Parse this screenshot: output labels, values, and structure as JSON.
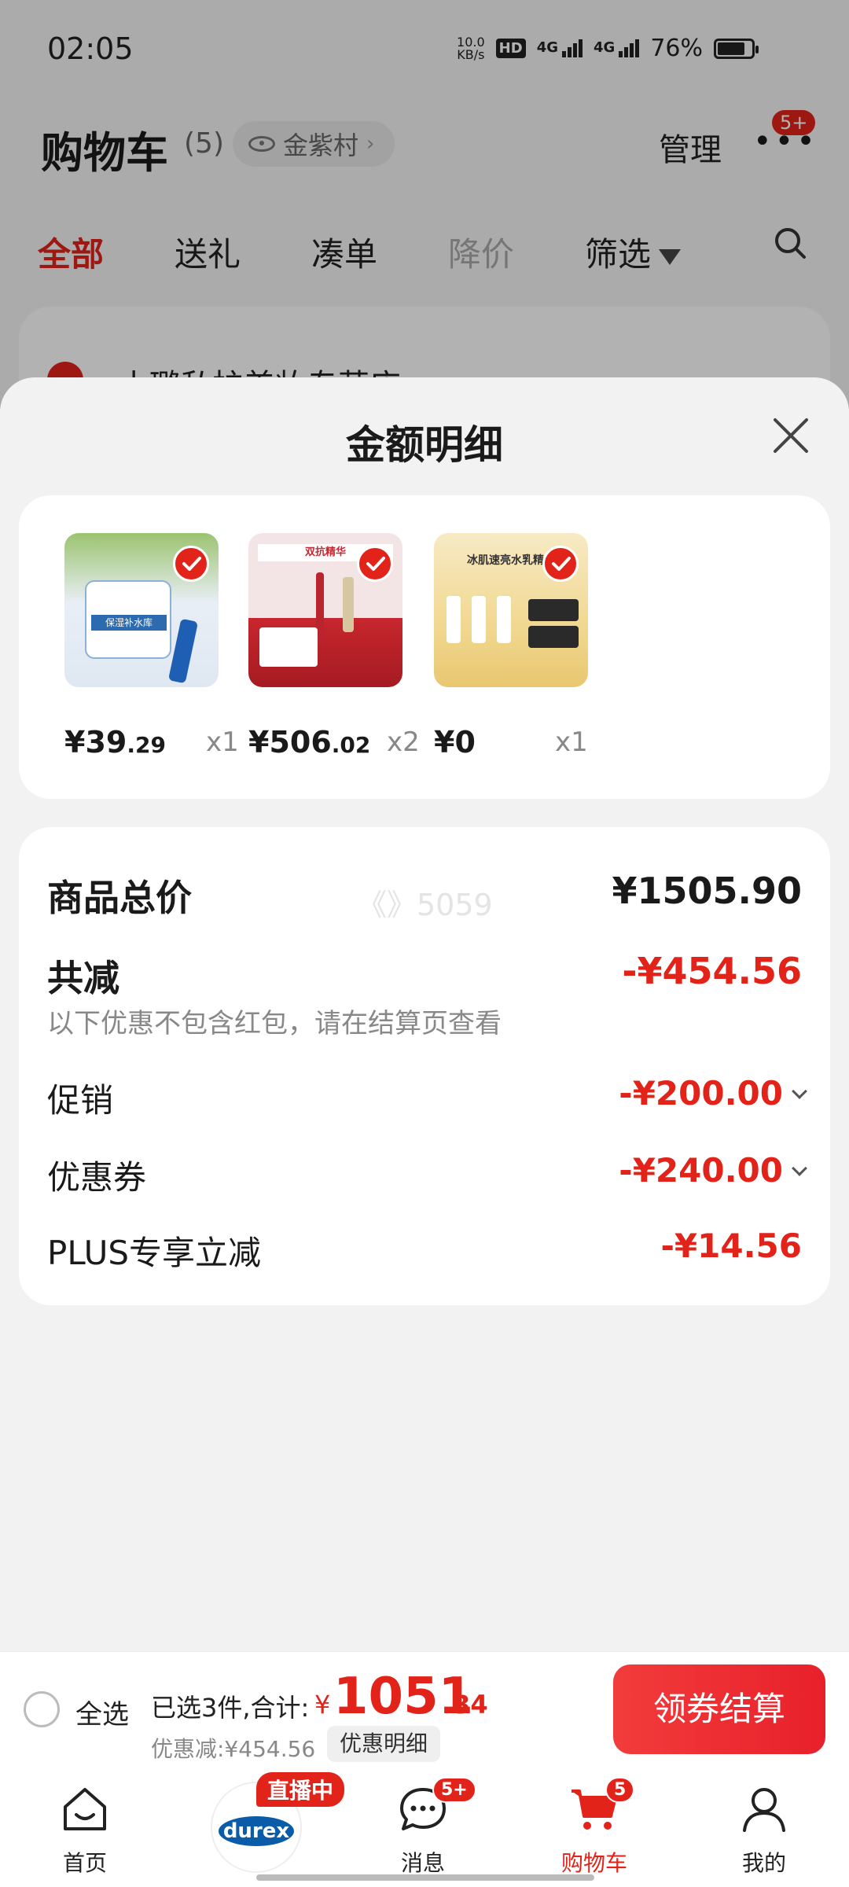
{
  "status_bar": {
    "time": "02:05",
    "net_speed_top": "10.0",
    "net_speed_bottom": "KB/s",
    "hd_label": "HD",
    "signal_1": "4G",
    "signal_2": "4G",
    "battery": "76%"
  },
  "header": {
    "title": "购物车",
    "count": "(5)",
    "location": "金紫村",
    "manage": "管理",
    "more_badge": "5+"
  },
  "filter_tabs": [
    {
      "label": "全部"
    },
    {
      "label": "送礼"
    },
    {
      "label": "凑单"
    },
    {
      "label": "降价"
    },
    {
      "label": "筛选"
    }
  ],
  "store": {
    "name": "小璐私护美妆专营店"
  },
  "sheet": {
    "title": "金额明细",
    "items": [
      {
        "price_int": "¥39",
        "price_dec": ".29",
        "qty": "x1",
        "color": "#dfe8f2",
        "tag": "保湿补水库"
      },
      {
        "price_int": "¥506",
        "price_dec": ".02",
        "qty": "x2",
        "color": "#c8262e",
        "tag": "双抗精华"
      },
      {
        "price_int": "¥0",
        "price_dec": "",
        "qty": "x1",
        "color": "#f1d891",
        "tag": "冰肌速亮水乳精华"
      }
    ],
    "detail": {
      "total_label": "商品总价",
      "total_value": "¥1505.90",
      "reduce_label": "共减",
      "reduce_value": "-¥454.56",
      "reduce_note": "以下优惠不包含红包，请在结算页查看",
      "promo_label": "促销",
      "promo_value": "-¥200.00",
      "coupon_label": "优惠券",
      "coupon_value": "-¥240.00",
      "plus_label": "PLUS专享立减",
      "plus_value": "-¥14.56",
      "watermark": "《》5059"
    }
  },
  "checkout": {
    "select_all": "全选",
    "summary": "已选3件,合计:",
    "currency": "¥",
    "total_int": "1051",
    "total_dec": ".34",
    "discount": "优惠减:¥454.56",
    "detail_chip": "优惠明细",
    "button": "领券结算"
  },
  "bottom_nav": {
    "home": "首页",
    "live_badge": "直播中",
    "durex": "durex",
    "messages": "消息",
    "messages_badge": "5+",
    "cart": "购物车",
    "cart_badge": "5",
    "mine": "我的"
  },
  "colors": {
    "accent": "#e2231a",
    "bg": "#f2f2f2"
  }
}
